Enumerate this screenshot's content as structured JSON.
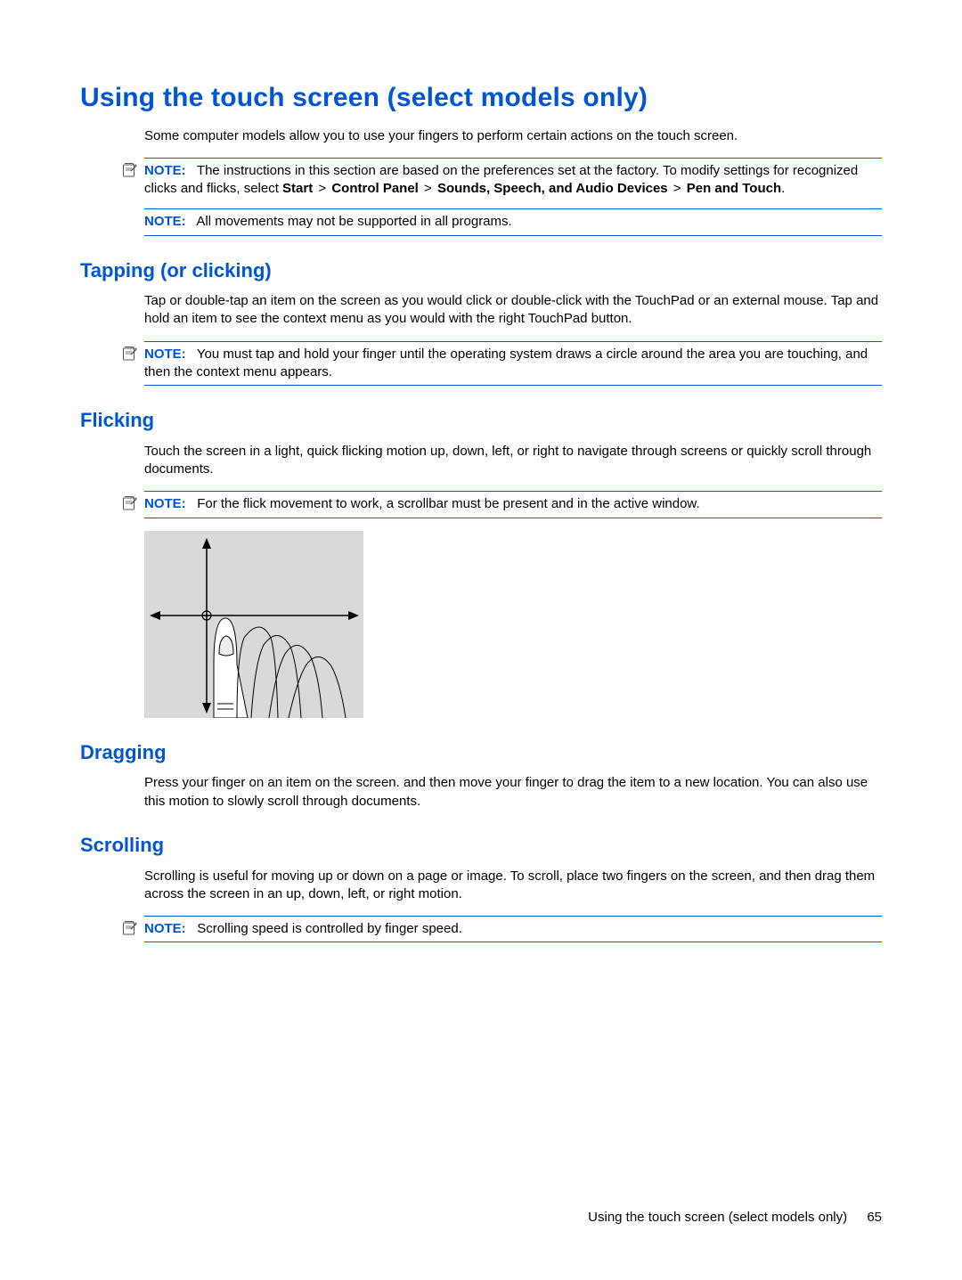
{
  "heading": "Using the touch screen (select models only)",
  "intro": "Some computer models allow you to use your fingers to perform certain actions on the touch screen.",
  "note1": {
    "label": "NOTE:",
    "text_before": "The instructions in this section are based on the preferences set at the factory. To modify settings for recognized clicks and flicks, select ",
    "path": {
      "p1": "Start",
      "p2": "Control Panel",
      "p3": "Sounds, Speech, and Audio Devices",
      "p4": "Pen and Touch"
    },
    "period": "."
  },
  "note2": {
    "label": "NOTE:",
    "text": "All movements may not be supported in all programs."
  },
  "tapping": {
    "heading": "Tapping (or clicking)",
    "body": "Tap or double-tap an item on the screen as you would click or double-click with the TouchPad or an external mouse. Tap and hold an item to see the context menu as you would with the right TouchPad button.",
    "note": {
      "label": "NOTE:",
      "text": "You must tap and hold your finger until the operating system draws a circle around the area you are touching, and then the context menu appears."
    }
  },
  "flicking": {
    "heading": "Flicking",
    "body": "Touch the screen in a light, quick flicking motion up, down, left, or right to navigate through screens or quickly scroll through documents.",
    "note": {
      "label": "NOTE:",
      "text": "For the flick movement to work, a scrollbar must be present and in the active window."
    }
  },
  "dragging": {
    "heading": "Dragging",
    "body": "Press your finger on an item on the screen. and then move your finger to drag the item to a new location. You can also use this motion to slowly scroll through documents."
  },
  "scrolling": {
    "heading": "Scrolling",
    "body": "Scrolling is useful for moving up or down on a page or image. To scroll, place two fingers on the screen, and then drag them across the screen in an up, down, left, or right motion.",
    "note": {
      "label": "NOTE:",
      "text": "Scrolling speed is controlled by finger speed."
    }
  },
  "footer": {
    "title": "Using the touch screen (select models only)",
    "page": "65"
  }
}
